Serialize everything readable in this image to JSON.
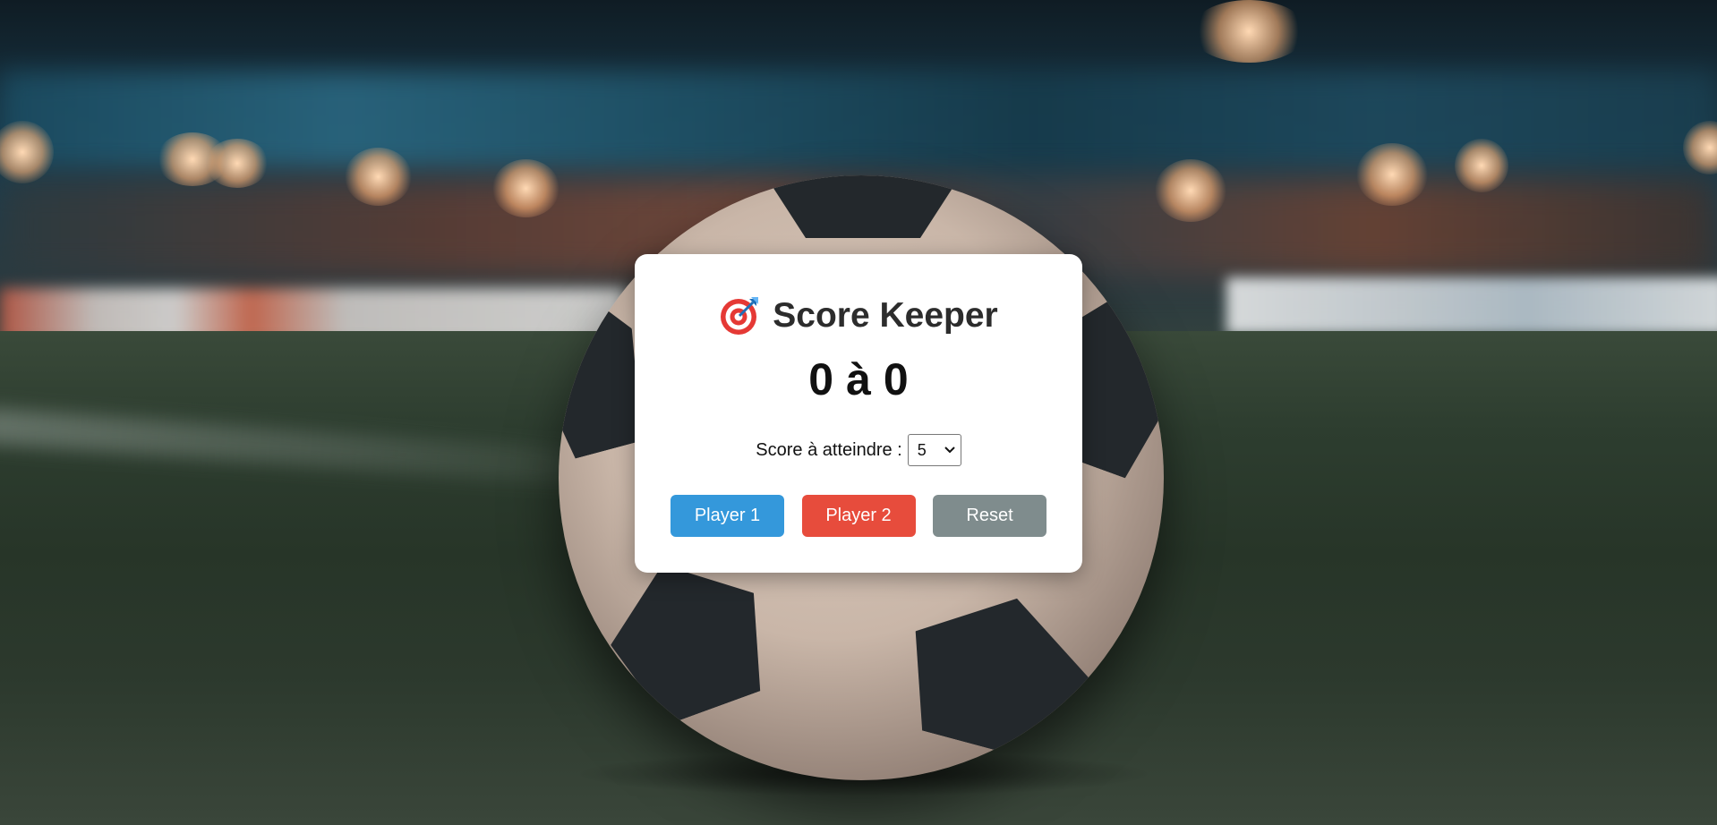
{
  "app": {
    "title": "Score Keeper",
    "title_icon": "target-icon"
  },
  "score": {
    "player1": "0",
    "separator": "à",
    "player2": "0"
  },
  "winning_score": {
    "label": "Score à atteindre :",
    "selected": "5"
  },
  "buttons": {
    "player1_label": "Player 1",
    "player2_label": "Player 2",
    "reset_label": "Reset"
  },
  "colors": {
    "player1": "#3498db",
    "player2": "#e74c3c",
    "reset": "#7f8c8d",
    "card": "#ffffff"
  }
}
